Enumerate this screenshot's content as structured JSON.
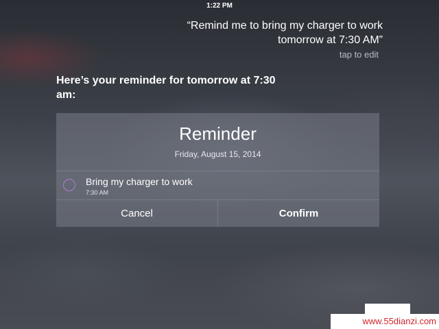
{
  "status_bar": {
    "time": "1:22 PM"
  },
  "siri": {
    "query_lines": [
      "“Remind me to bring my charger to work",
      "tomorrow at 7:30 AM”"
    ],
    "tap_to_edit": "tap to edit",
    "response_lines": [
      "Here’s your reminder for tomorrow at 7:30",
      "am:"
    ]
  },
  "reminder_card": {
    "title": "Reminder",
    "date": "Friday, August 15, 2014",
    "item": {
      "text": "Bring my charger to work",
      "time": "7:30 AM"
    },
    "cancel_label": "Cancel",
    "confirm_label": "Confirm"
  },
  "watermark": {
    "text": "www.55dianzi.com"
  },
  "colors": {
    "checkbox_ring": "#b478e0",
    "watermark_text": "#d2262c"
  }
}
